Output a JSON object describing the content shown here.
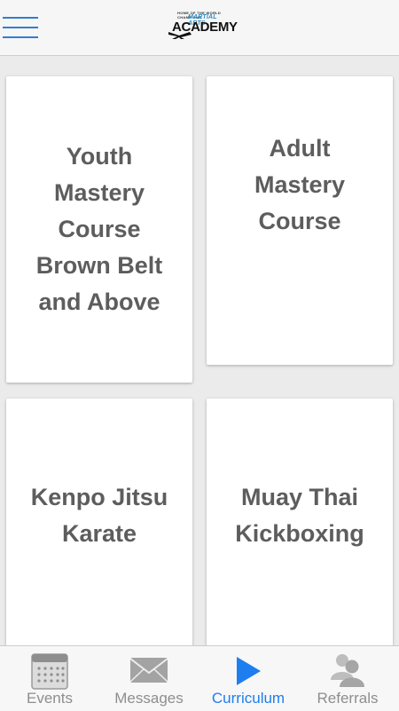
{
  "header": {
    "logo": {
      "small_text": "HOME OF THE WORLD CHAMPIONS",
      "mid_text": "MARTIAL ARTS",
      "main_text": "ACADEMY"
    }
  },
  "cards": [
    {
      "label": "Youth Mastery Course Brown Belt and Above"
    },
    {
      "label": "Adult Mastery Course"
    },
    {
      "label": "Kenpo Jitsu Karate"
    },
    {
      "label": "Muay Thai Kickboxing"
    }
  ],
  "tabs": [
    {
      "label": "Events",
      "icon": "calendar-icon",
      "active": false
    },
    {
      "label": "Messages",
      "icon": "envelope-icon",
      "active": false
    },
    {
      "label": "Curriculum",
      "icon": "play-icon",
      "active": true
    },
    {
      "label": "Referrals",
      "icon": "people-icon",
      "active": false
    }
  ],
  "colors": {
    "accent": "#1e7ef0",
    "menu_icon": "#2f7fd1",
    "card_text": "#5d5d5d",
    "tab_text": "#8e8e8e",
    "background": "#ebebeb"
  }
}
